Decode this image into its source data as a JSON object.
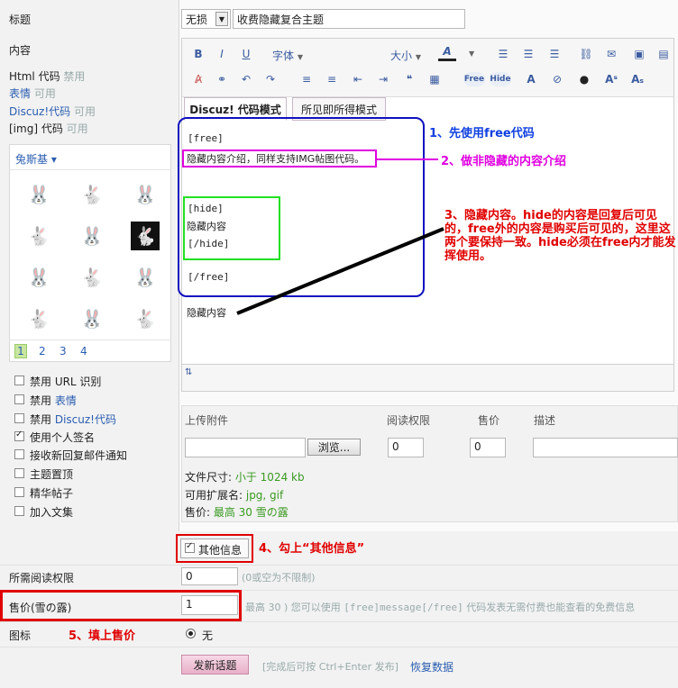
{
  "labels": {
    "title": "标题",
    "content": "内容",
    "html_code": "Html 代码",
    "html_code_status": "禁用",
    "emoji": "表情",
    "emoji_status": "可用",
    "discuz_code": "Discuz!代码",
    "discuz_code_status": "可用",
    "img_code": "[img] 代码",
    "img_code_status": "可用",
    "emoji_set": "兔斯基",
    "read_permission": "所需阅读权限",
    "price": "售价(雪の露)",
    "icon": "图标"
  },
  "title_row": {
    "select_value": "无损",
    "input_value": "收费隐藏复合主题"
  },
  "toolbar": {
    "bold": "B",
    "italic": "I",
    "underline": "U",
    "font": "字体",
    "size": "大小",
    "fontcolor": "A",
    "free": "Free",
    "hide": "Hide"
  },
  "tabs": {
    "discuz_mode": "Discuz! 代码模式",
    "wysiwyg_mode": "所见即所得模式"
  },
  "editor": {
    "line1": "[free]",
    "line2": "隐藏内容介绍，同样支持IMG帖图代码。",
    "line3": "[hide]",
    "line4": "隐藏内容",
    "line5": "[/hide]",
    "line6": "[/free]",
    "line7": "隐藏内容"
  },
  "annotations": {
    "a1": "1、先使用free代码",
    "a2": "2、做非隐藏的内容介绍",
    "a3": "3、隐藏内容。hide的内容是回复后可见的，free外的内容是购买后可见的，这里这两个要保持一致。hide必须在free内才能发挥使用。",
    "a4": "4、勾上“其他信息”",
    "a5": "5、填上售价"
  },
  "emoji_pages": [
    "1",
    "2",
    "3",
    "4"
  ],
  "options": [
    {
      "label": "禁用 URL 识别",
      "checked": false
    },
    {
      "label": "禁用 ",
      "link": "表情",
      "checked": false
    },
    {
      "label": "禁用 ",
      "link": "Discuz!代码",
      "checked": false
    },
    {
      "label": "使用个人签名",
      "checked": true
    },
    {
      "label": "接收新回复邮件通知",
      "checked": false
    },
    {
      "label": "主题置顶",
      "checked": false
    },
    {
      "label": "精华帖子",
      "checked": false
    },
    {
      "label": "加入文集",
      "checked": false
    }
  ],
  "attachments": {
    "col_upload": "上传附件",
    "col_permission": "阅读权限",
    "col_price": "售价",
    "col_desc": "描述",
    "browse": "浏览...",
    "permission_value": "0",
    "price_value": "0",
    "size_label": "文件尺寸: ",
    "size_value": "小于 1024 kb",
    "ext_label": "可用扩展名: ",
    "ext_value": "jpg, gif",
    "price_label": "售价: ",
    "price_text": "最高 30 雪の露"
  },
  "other_info": "其他信息",
  "read_permission_value": "0",
  "read_permission_hint": "(0或空为不限制)",
  "price_value": "1",
  "price_hint_pre": "最高 30 ) 您可以使用 ",
  "price_hint_code1": "[free]message[/free]",
  "price_hint_post": " 代码发表无需付费也能查看的免费信息",
  "icon_option": "无",
  "submit": "发新话题",
  "submit_hint": "[完成后可按 Ctrl+Enter 发布]",
  "restore": "恢复数据"
}
